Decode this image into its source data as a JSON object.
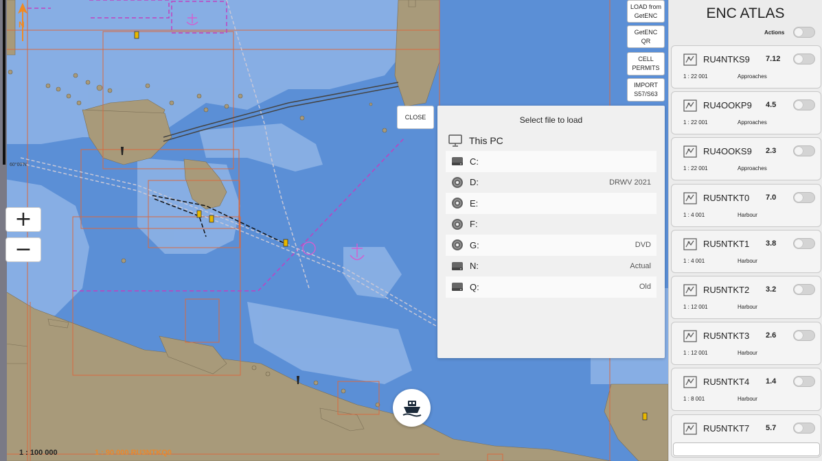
{
  "map": {
    "scale_main": "1 : 100 000",
    "scale_cell": "1 : 90 000  RU3NTKQ0",
    "lat_label": "60°00'N",
    "zoom_in": "+",
    "zoom_out": "−"
  },
  "side_buttons": {
    "load_getenc": "LOAD from GetENC",
    "getenc_qr": "GetENC QR",
    "cell_permits": "CELL PERMITS",
    "import_s57": "IMPORT S57/S63"
  },
  "file_dialog": {
    "close_label": "CLOSE",
    "title": "Select file to load",
    "this_pc": "This PC",
    "drives": [
      {
        "letter": "C:",
        "label": "",
        "icon": "hard-drive-icon"
      },
      {
        "letter": "D:",
        "label": "DRWV 2021",
        "icon": "disc-icon"
      },
      {
        "letter": "E:",
        "label": "",
        "icon": "disc-icon"
      },
      {
        "letter": "F:",
        "label": "",
        "icon": "disc-icon"
      },
      {
        "letter": "G:",
        "label": "DVD",
        "icon": "disc-icon"
      },
      {
        "letter": "N:",
        "label": "Actual",
        "icon": "hard-drive-icon"
      },
      {
        "letter": "Q:",
        "label": "Old",
        "icon": "hard-drive-icon"
      }
    ]
  },
  "atlas": {
    "title": "ENC ATLAS",
    "actions_label": "Actions",
    "cells": [
      {
        "name": "RU4NTKS9",
        "version": "7.12",
        "scale": "1 : 22 001",
        "usage": "Approaches"
      },
      {
        "name": "RU4OOKP9",
        "version": "4.5",
        "scale": "1 : 22 001",
        "usage": "Approaches"
      },
      {
        "name": "RU4OOKS9",
        "version": "2.3",
        "scale": "1 : 22 001",
        "usage": "Approaches"
      },
      {
        "name": "RU5NTKT0",
        "version": "7.0",
        "scale": "1 : 4 001",
        "usage": "Harbour"
      },
      {
        "name": "RU5NTKT1",
        "version": "3.8",
        "scale": "1 : 4 001",
        "usage": "Harbour"
      },
      {
        "name": "RU5NTKT2",
        "version": "3.2",
        "scale": "1 : 12 001",
        "usage": "Harbour"
      },
      {
        "name": "RU5NTKT3",
        "version": "2.6",
        "scale": "1 : 12 001",
        "usage": "Harbour"
      },
      {
        "name": "RU5NTKT4",
        "version": "1.4",
        "scale": "1 : 8 001",
        "usage": "Harbour"
      },
      {
        "name": "RU5NTKT7",
        "version": "5.7",
        "scale": "",
        "usage": ""
      }
    ]
  },
  "colors": {
    "deep_water": "#5b8fd6",
    "shallow_water": "#8fb4e6",
    "land": "#a89a7a",
    "cell_border": "#d86a40",
    "restricted": "#c040c0"
  }
}
